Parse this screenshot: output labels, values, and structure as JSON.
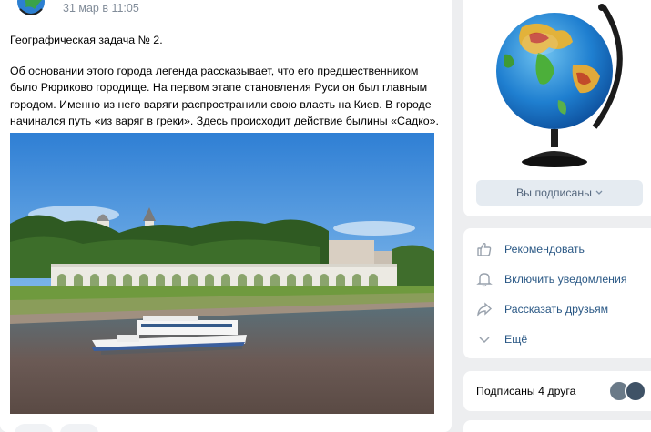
{
  "post": {
    "date": "31 мар в 11:05",
    "title": "Географическая задача № 2.",
    "body": "Об основании этого города легенда рассказывает, что его предшественником было Рюриково городище. На первом этапе становления Руси он был главным городом. Именно из него варяги распространили свою власть на Киев. В городе начинался путь «из варяг в греки». Здесь происходит действие былины «Садко»."
  },
  "sidebar": {
    "subscribe_label": "Вы подписаны",
    "menu": [
      {
        "label": "Рекомендовать",
        "icon": "thumb-up-icon"
      },
      {
        "label": "Включить уведомления",
        "icon": "bell-icon"
      },
      {
        "label": "Рассказать друзьям",
        "icon": "share-arrow-icon"
      },
      {
        "label": "Ещё",
        "icon": "chevron-down-icon"
      }
    ],
    "friends_label": "Подписаны 4 друга"
  },
  "colors": {
    "link": "#2a5885",
    "meta": "#818c99",
    "page_bg": "#edeef0",
    "button_bg": "#e5ebf1"
  }
}
